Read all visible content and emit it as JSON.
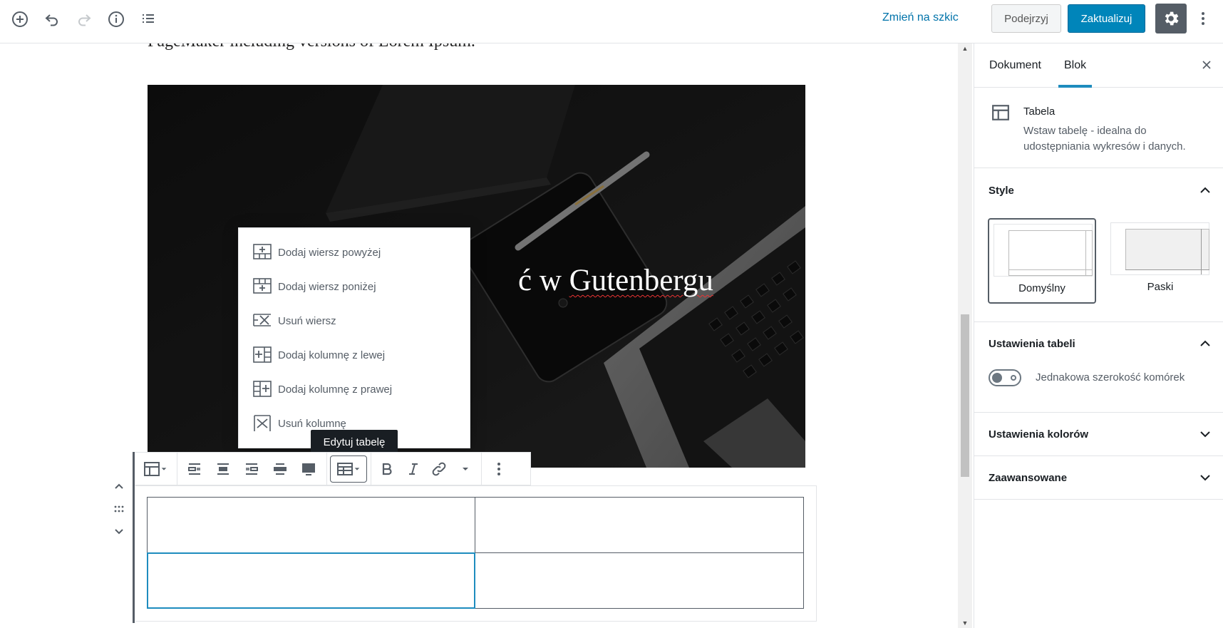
{
  "topbar": {
    "switch_to_draft": "Zmień na szkic",
    "preview": "Podejrzyj",
    "update": "Zaktualizuj",
    "colors": {
      "primary": "#0085ba",
      "link": "#0073aa",
      "settings_bg": "#555d66"
    }
  },
  "editor": {
    "partial_text": "PageMaker including versions of Lorem Ipsum.",
    "cover_title_visible": "ć w ",
    "cover_title_underlined": "Gutenbergu"
  },
  "table_menu": {
    "items": [
      {
        "label": "Dodaj wiersz powyżej",
        "icon": "table-row-before-icon"
      },
      {
        "label": "Dodaj wiersz poniżej",
        "icon": "table-row-after-icon"
      },
      {
        "label": "Usuń wiersz",
        "icon": "table-row-delete-icon"
      },
      {
        "label": "Dodaj kolumnę z lewej",
        "icon": "table-col-before-icon"
      },
      {
        "label": "Dodaj kolumnę z prawej",
        "icon": "table-col-after-icon"
      },
      {
        "label": "Usuń kolumnę",
        "icon": "table-col-delete-icon"
      }
    ]
  },
  "tooltip": {
    "label": "Edytuj tabelę"
  },
  "table": {
    "rows": [
      [
        "",
        ""
      ],
      [
        "",
        ""
      ]
    ],
    "selected_cell": [
      1,
      0
    ]
  },
  "sidebar": {
    "tabs": [
      {
        "label": "Dokument"
      },
      {
        "label": "Blok"
      }
    ],
    "active_tab": "Blok",
    "block": {
      "title": "Tabela",
      "description": "Wstaw tabelę - idealna do udostępniania wykresów i danych."
    },
    "styles_panel": {
      "title": "Style",
      "options": [
        {
          "label": "Domyślny"
        },
        {
          "label": "Paski"
        }
      ],
      "selected": "Domyślny"
    },
    "table_settings_panel": {
      "title": "Ustawienia tabeli",
      "toggle_label": "Jednakowa szerokość komórek",
      "toggle_on": false
    },
    "color_settings_panel": {
      "title": "Ustawienia kolorów"
    },
    "advanced_panel": {
      "title": "Zaawansowane"
    }
  }
}
